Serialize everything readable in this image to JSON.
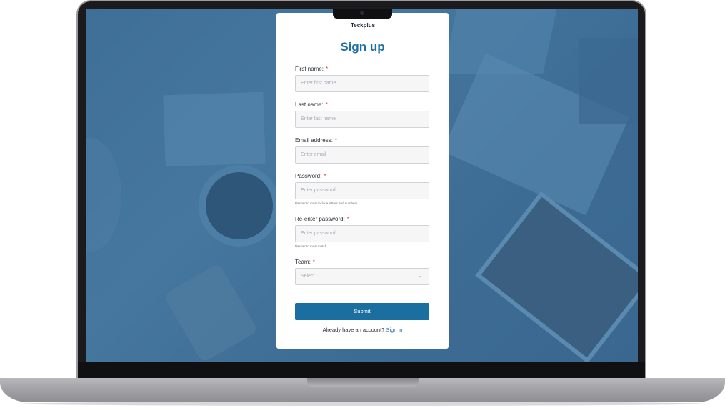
{
  "brand": {
    "logo_text": "Teckplus"
  },
  "form": {
    "title": "Sign up",
    "fields": {
      "first_name": {
        "label": "First name:",
        "required_mark": "*",
        "placeholder": "Enter first name"
      },
      "last_name": {
        "label": "Last name:",
        "required_mark": "*",
        "placeholder": "Enter last name"
      },
      "email": {
        "label": "Email address:",
        "required_mark": "*",
        "placeholder": "Enter email"
      },
      "password": {
        "label": "Password:",
        "required_mark": "*",
        "placeholder": "Enter password",
        "hint": "Password must include letters and numbers"
      },
      "password_confirm": {
        "label": "Re-enter password:",
        "required_mark": "*",
        "placeholder": "Enter password",
        "hint": "Password must match"
      },
      "team": {
        "label": "Team:",
        "required_mark": "*",
        "selected": "Select",
        "chevron_icon": "chevron-down-icon"
      }
    },
    "submit_label": "Submit",
    "signin_prompt": "Already have an account?",
    "signin_link": "Sign in"
  },
  "colors": {
    "accent": "#1b6ea0",
    "required": "#e23a3a",
    "overlay": "#3f6f97"
  }
}
